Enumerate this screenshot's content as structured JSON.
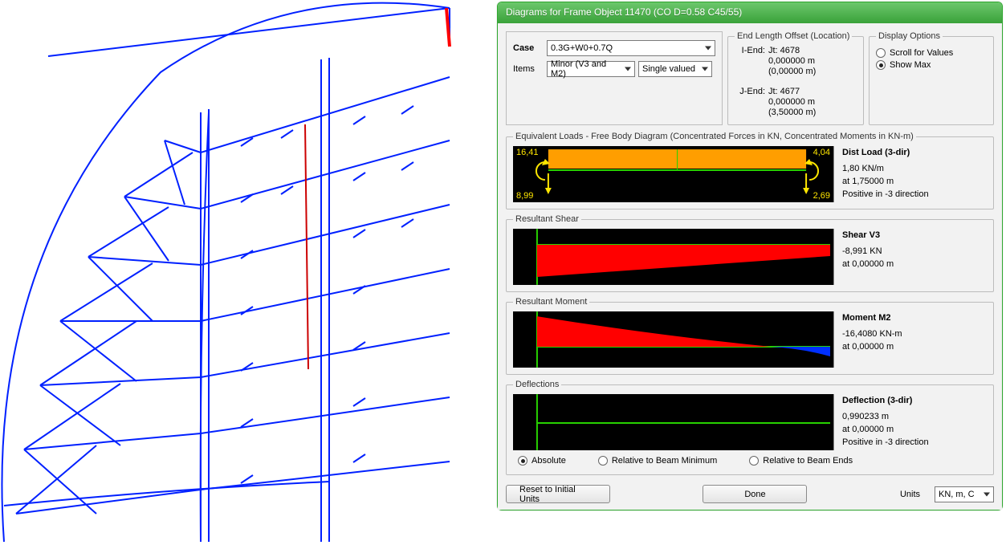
{
  "window": {
    "title": "Diagrams for Frame Object 11470  (CO D=0.58 C45/55)"
  },
  "case_box": {
    "case_label": "Case",
    "case_value": "0.3G+W0+0.7Q",
    "items_label": "Items",
    "items_value": "Minor (V3 and M2)",
    "single_valued": "Single valued"
  },
  "end_offset": {
    "legend": "End Length Offset (Location)",
    "i_end_label": "I-End:",
    "i_jt": "Jt:  4678",
    "i_val": "0,000000 m",
    "i_loc": "(0,00000 m)",
    "j_end_label": "J-End:",
    "j_jt": "Jt:  4677",
    "j_val": "0,000000 m",
    "j_loc": "(3,50000 m)"
  },
  "display_options": {
    "legend": "Display Options",
    "scroll": "Scroll for Values",
    "show_max": "Show Max",
    "selected": "show_max"
  },
  "eqloads": {
    "legend": "Equivalent Loads - Free Body Diagram  (Concentrated Forces in KN, Concentrated Moments in KN-m)",
    "tl": "16,41",
    "bl": "8,99",
    "tr": "4,04",
    "br": "2,69",
    "info_title": "Dist Load (3-dir)",
    "info_l1": "1,80 KN/m",
    "info_l2": "at 1,75000 m",
    "info_l3": "Positive in -3 direction"
  },
  "shear": {
    "legend": "Resultant Shear",
    "info_title": "Shear V3",
    "info_l1": "-8,991 KN",
    "info_l2": "at 0,00000 m"
  },
  "moment": {
    "legend": "Resultant Moment",
    "info_title": "Moment M2",
    "info_l1": "-16,4080 KN-m",
    "info_l2": "at 0,00000 m"
  },
  "defl": {
    "legend": "Deflections",
    "info_title": "Deflection (3-dir)",
    "info_l1": "0,990233 m",
    "info_l2": "at 0,00000 m",
    "info_l3": "Positive in -3 direction",
    "ref_abs": "Absolute",
    "ref_min": "Relative to Beam Minimum",
    "ref_ends": "Relative to Beam Ends",
    "ref_selected": "abs"
  },
  "bottom": {
    "reset": "Reset to Initial Units",
    "done": "Done",
    "units_label": "Units",
    "units_value": "KN, m, C"
  },
  "chart_data": [
    {
      "type": "diagram",
      "name": "Equivalent Loads / Free Body",
      "length_m": 3.5,
      "dist_load_KN_per_m": 1.8,
      "dist_load_direction": "-3",
      "i_end_moment_KNm": 16.41,
      "i_end_shear_KN": 8.99,
      "j_end_moment_KNm": 4.04,
      "j_end_shear_KN": 2.69
    },
    {
      "type": "line",
      "name": "Shear V3",
      "x": [
        0,
        3.5
      ],
      "values": [
        -8.991,
        -2.69
      ],
      "units": "KN",
      "max_abs": -8.991,
      "max_abs_at_m": 0.0
    },
    {
      "type": "line",
      "name": "Moment M2",
      "x": [
        0,
        3.5
      ],
      "values": [
        -16.408,
        4.04
      ],
      "units": "KN-m",
      "max_abs": -16.408,
      "max_abs_at_m": 0.0
    },
    {
      "type": "line",
      "name": "Deflection (3-dir)",
      "x": [
        0,
        3.5
      ],
      "values": [
        0.990233,
        0.0
      ],
      "units": "m",
      "max_abs": 0.990233,
      "max_abs_at_m": 0.0,
      "direction": "-3"
    }
  ]
}
